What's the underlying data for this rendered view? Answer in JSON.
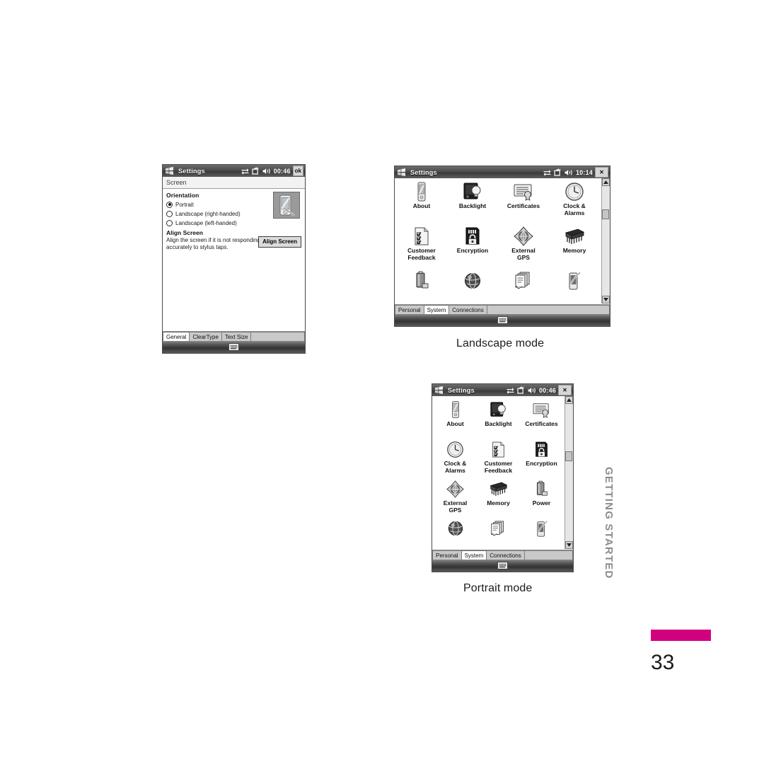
{
  "page": {
    "number": "33",
    "side_label": "GETTING STARTED",
    "accent_color": "#d1007f",
    "side_label_color": "#8c8c8c"
  },
  "captions": {
    "landscape": "Landscape mode",
    "portrait": "Portrait mode"
  },
  "screen_settings": {
    "titlebar": {
      "app": "Settings",
      "time": "00:46",
      "ok_label": "ok",
      "icons": [
        "windows-logo-icon",
        "connectivity-icon",
        "signal-icon",
        "volume-icon"
      ]
    },
    "subheader": "Screen",
    "orientation": {
      "heading": "Orientation",
      "options": [
        {
          "label": "Portrait",
          "selected": true
        },
        {
          "label": "Landscape (right-handed)",
          "selected": false
        },
        {
          "label": "Landscape (left-handed)",
          "selected": false
        }
      ]
    },
    "align": {
      "heading": "Align Screen",
      "description": "Align the screen if it is not responding accurately to stylus taps.",
      "button_label": "Align Screen"
    },
    "tabs": [
      {
        "label": "General",
        "selected": true
      },
      {
        "label": "ClearType",
        "selected": false
      },
      {
        "label": "Text Size",
        "selected": false
      }
    ]
  },
  "landscape_screen": {
    "titlebar": {
      "app": "Settings",
      "time": "10:14",
      "close_label": "✕",
      "icons": [
        "windows-logo-icon",
        "connectivity-icon",
        "signal-icon",
        "volume-icon"
      ]
    },
    "icons": [
      {
        "label": "About",
        "icon": "device-icon"
      },
      {
        "label": "Backlight",
        "icon": "backlight-icon"
      },
      {
        "label": "Certificates",
        "icon": "certificate-icon"
      },
      {
        "label": "Clock &\nAlarms",
        "icon": "clock-icon"
      },
      {
        "label": "Customer\nFeedback",
        "icon": "checklist-icon"
      },
      {
        "label": "Encryption",
        "icon": "lock-card-icon"
      },
      {
        "label": "External\nGPS",
        "icon": "globe-compass-icon"
      },
      {
        "label": "Memory",
        "icon": "memory-chip-icon"
      },
      {
        "label": "",
        "icon": "battery-icon"
      },
      {
        "label": "",
        "icon": "globe-icon"
      },
      {
        "label": "",
        "icon": "regional-icon"
      },
      {
        "label": "",
        "icon": "screen-stylus-icon"
      }
    ],
    "tabs": [
      {
        "label": "Personal",
        "selected": false
      },
      {
        "label": "System",
        "selected": true
      },
      {
        "label": "Connections",
        "selected": false
      }
    ]
  },
  "portrait_screen": {
    "titlebar": {
      "app": "Settings",
      "time": "00:46",
      "close_label": "✕",
      "icons": [
        "windows-logo-icon",
        "connectivity-icon",
        "signal-icon",
        "volume-icon"
      ]
    },
    "icons": [
      {
        "label": "About",
        "icon": "device-icon"
      },
      {
        "label": "Backlight",
        "icon": "backlight-icon"
      },
      {
        "label": "Certificates",
        "icon": "certificate-icon"
      },
      {
        "label": "Clock &\nAlarms",
        "icon": "clock-icon"
      },
      {
        "label": "Customer\nFeedback",
        "icon": "checklist-icon"
      },
      {
        "label": "Encryption",
        "icon": "lock-card-icon"
      },
      {
        "label": "External\nGPS",
        "icon": "globe-compass-icon"
      },
      {
        "label": "Memory",
        "icon": "memory-chip-icon"
      },
      {
        "label": "Power",
        "icon": "battery-icon"
      },
      {
        "label": "",
        "icon": "globe-icon"
      },
      {
        "label": "",
        "icon": "regional-icon"
      },
      {
        "label": "",
        "icon": "screen-stylus-icon"
      }
    ],
    "tabs": [
      {
        "label": "Personal",
        "selected": false
      },
      {
        "label": "System",
        "selected": true
      },
      {
        "label": "Connections",
        "selected": false
      }
    ]
  }
}
